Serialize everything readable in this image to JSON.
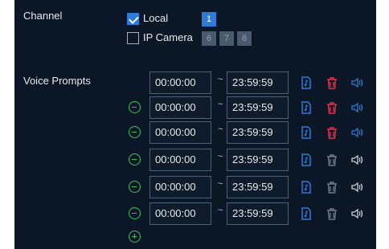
{
  "channel": {
    "label": "Channel",
    "local": {
      "label": "Local",
      "checked": true,
      "channels": [
        "1"
      ]
    },
    "ip_camera": {
      "label": "IP Camera",
      "checked": false,
      "channels": [
        "6",
        "7",
        "8"
      ]
    }
  },
  "voice_prompts": {
    "label": "Voice Prompts",
    "rows": [
      {
        "start": "00:00:00",
        "end": "23:59:59",
        "removable": false,
        "active": true
      },
      {
        "start": "00:00:00",
        "end": "23:59:59",
        "removable": true,
        "active": true
      },
      {
        "start": "00:00:00",
        "end": "23:59:59",
        "removable": true,
        "active": true
      },
      {
        "start": "00:00:00",
        "end": "23:59:59",
        "removable": true,
        "active": false
      },
      {
        "start": "00:00:00",
        "end": "23:59:59",
        "removable": true,
        "active": false
      },
      {
        "start": "00:00:00",
        "end": "23:59:59",
        "removable": true,
        "active": false
      }
    ],
    "separator": "~"
  },
  "colors": {
    "accent_blue": "#2e7bd8",
    "delete_red": "#e8304a",
    "disabled_gray": "#6e7c8a",
    "add_green": "#35c45a"
  },
  "icons": {
    "add": "plus-circle-icon",
    "remove": "minus-circle-icon",
    "file": "audio-file-icon",
    "delete": "trash-icon",
    "volume": "speaker-icon"
  }
}
